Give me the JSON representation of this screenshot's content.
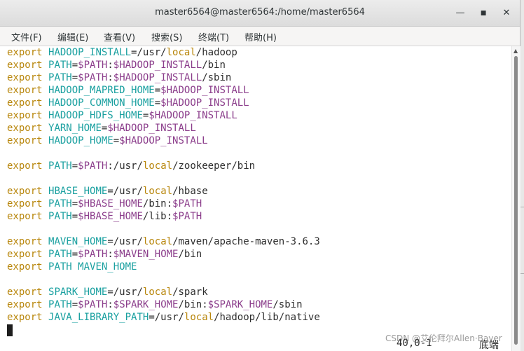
{
  "window": {
    "title": "master6564@master6564:/home/master6564",
    "minimize_icon": "minimize-icon",
    "maximize_icon": "maximize-icon",
    "close_icon": "close-icon",
    "minimize_glyph": "—",
    "maximize_glyph": "■",
    "close_glyph": "✕"
  },
  "menu": {
    "items": [
      {
        "label": "文件(F)"
      },
      {
        "label": "编辑(E)"
      },
      {
        "label": "查看(V)"
      },
      {
        "label": "搜索(S)"
      },
      {
        "label": "终端(T)"
      },
      {
        "label": "帮助(H)"
      }
    ]
  },
  "colors": {
    "keyword": "#b8860b",
    "variable_name": "#1aa0a0",
    "variable_ref": "#8b3d8b",
    "path_local": "#b8860b"
  },
  "terminal": {
    "lines": [
      [
        {
          "t": "export",
          "c": "kw"
        },
        {
          "t": " "
        },
        {
          "t": "HADOOP_INSTALL",
          "c": "vn"
        },
        {
          "t": "="
        },
        {
          "t": "/usr/"
        },
        {
          "t": "local",
          "c": "lc"
        },
        {
          "t": "/hadoop"
        }
      ],
      [
        {
          "t": "export",
          "c": "kw"
        },
        {
          "t": " "
        },
        {
          "t": "PATH",
          "c": "vn"
        },
        {
          "t": "="
        },
        {
          "t": "$PATH",
          "c": "vv"
        },
        {
          "t": ":"
        },
        {
          "t": "$HADOOP_INSTALL",
          "c": "vv"
        },
        {
          "t": "/bin"
        }
      ],
      [
        {
          "t": "export",
          "c": "kw"
        },
        {
          "t": " "
        },
        {
          "t": "PATH",
          "c": "vn"
        },
        {
          "t": "="
        },
        {
          "t": "$PATH",
          "c": "vv"
        },
        {
          "t": ":"
        },
        {
          "t": "$HADOOP_INSTALL",
          "c": "vv"
        },
        {
          "t": "/sbin"
        }
      ],
      [
        {
          "t": "export",
          "c": "kw"
        },
        {
          "t": " "
        },
        {
          "t": "HADOOP_MAPRED_HOME",
          "c": "vn"
        },
        {
          "t": "="
        },
        {
          "t": "$HADOOP_INSTALL",
          "c": "vv"
        }
      ],
      [
        {
          "t": "export",
          "c": "kw"
        },
        {
          "t": " "
        },
        {
          "t": "HADOOP_COMMON_HOME",
          "c": "vn"
        },
        {
          "t": "="
        },
        {
          "t": "$HADOOP_INSTALL",
          "c": "vv"
        }
      ],
      [
        {
          "t": "export",
          "c": "kw"
        },
        {
          "t": " "
        },
        {
          "t": "HADOOP_HDFS_HOME",
          "c": "vn"
        },
        {
          "t": "="
        },
        {
          "t": "$HADOOP_INSTALL",
          "c": "vv"
        }
      ],
      [
        {
          "t": "export",
          "c": "kw"
        },
        {
          "t": " "
        },
        {
          "t": "YARN_HOME",
          "c": "vn"
        },
        {
          "t": "="
        },
        {
          "t": "$HADOOP_INSTALL",
          "c": "vv"
        }
      ],
      [
        {
          "t": "export",
          "c": "kw"
        },
        {
          "t": " "
        },
        {
          "t": "HADOOP_HOME",
          "c": "vn"
        },
        {
          "t": "="
        },
        {
          "t": "$HADOOP_INSTALL",
          "c": "vv"
        }
      ],
      [],
      [
        {
          "t": "export",
          "c": "kw"
        },
        {
          "t": " "
        },
        {
          "t": "PATH",
          "c": "vn"
        },
        {
          "t": "="
        },
        {
          "t": "$PATH",
          "c": "vv"
        },
        {
          "t": ":"
        },
        {
          "t": "/usr/"
        },
        {
          "t": "local",
          "c": "lc"
        },
        {
          "t": "/zookeeper/bin"
        }
      ],
      [],
      [
        {
          "t": "export",
          "c": "kw"
        },
        {
          "t": " "
        },
        {
          "t": "HBASE_HOME",
          "c": "vn"
        },
        {
          "t": "="
        },
        {
          "t": "/usr/"
        },
        {
          "t": "local",
          "c": "lc"
        },
        {
          "t": "/hbase"
        }
      ],
      [
        {
          "t": "export",
          "c": "kw"
        },
        {
          "t": " "
        },
        {
          "t": "PATH",
          "c": "vn"
        },
        {
          "t": "="
        },
        {
          "t": "$HBASE_HOME",
          "c": "vv"
        },
        {
          "t": "/bin:"
        },
        {
          "t": "$PATH",
          "c": "vv"
        }
      ],
      [
        {
          "t": "export",
          "c": "kw"
        },
        {
          "t": " "
        },
        {
          "t": "PATH",
          "c": "vn"
        },
        {
          "t": "="
        },
        {
          "t": "$HBASE_HOME",
          "c": "vv"
        },
        {
          "t": "/lib:"
        },
        {
          "t": "$PATH",
          "c": "vv"
        }
      ],
      [],
      [
        {
          "t": "export",
          "c": "kw"
        },
        {
          "t": " "
        },
        {
          "t": "MAVEN_HOME",
          "c": "vn"
        },
        {
          "t": "="
        },
        {
          "t": "/usr/"
        },
        {
          "t": "local",
          "c": "lc"
        },
        {
          "t": "/maven/apache-maven-3.6.3"
        }
      ],
      [
        {
          "t": "export",
          "c": "kw"
        },
        {
          "t": " "
        },
        {
          "t": "PATH",
          "c": "vn"
        },
        {
          "t": "="
        },
        {
          "t": "$PATH",
          "c": "vv"
        },
        {
          "t": ":"
        },
        {
          "t": "$MAVEN_HOME",
          "c": "vv"
        },
        {
          "t": "/bin"
        }
      ],
      [
        {
          "t": "export",
          "c": "kw"
        },
        {
          "t": " "
        },
        {
          "t": "PATH MAVEN_HOME",
          "c": "vn"
        }
      ],
      [],
      [
        {
          "t": "export",
          "c": "kw"
        },
        {
          "t": " "
        },
        {
          "t": "SPARK_HOME",
          "c": "vn"
        },
        {
          "t": "="
        },
        {
          "t": "/usr/"
        },
        {
          "t": "local",
          "c": "lc"
        },
        {
          "t": "/spark"
        }
      ],
      [
        {
          "t": "export",
          "c": "kw"
        },
        {
          "t": " "
        },
        {
          "t": "PATH",
          "c": "vn"
        },
        {
          "t": "="
        },
        {
          "t": "$PATH",
          "c": "vv"
        },
        {
          "t": ":"
        },
        {
          "t": "$SPARK_HOME",
          "c": "vv"
        },
        {
          "t": "/bin:"
        },
        {
          "t": "$SPARK_HOME",
          "c": "vv"
        },
        {
          "t": "/sbin"
        }
      ],
      [
        {
          "t": "export",
          "c": "kw"
        },
        {
          "t": " "
        },
        {
          "t": "JAVA_LIBRARY_PATH",
          "c": "vn"
        },
        {
          "t": "="
        },
        {
          "t": "/usr/"
        },
        {
          "t": "local",
          "c": "lc"
        },
        {
          "t": "/hadoop/lib/native"
        }
      ]
    ]
  },
  "status": {
    "position": "40,0-1",
    "scroll": "底端"
  },
  "watermark": "CSDN @艾伦拜尔Allen·Bayer",
  "scrollbar": {
    "up_arrow_icon": "scroll-up-arrow-icon",
    "up_glyph": "▲"
  }
}
